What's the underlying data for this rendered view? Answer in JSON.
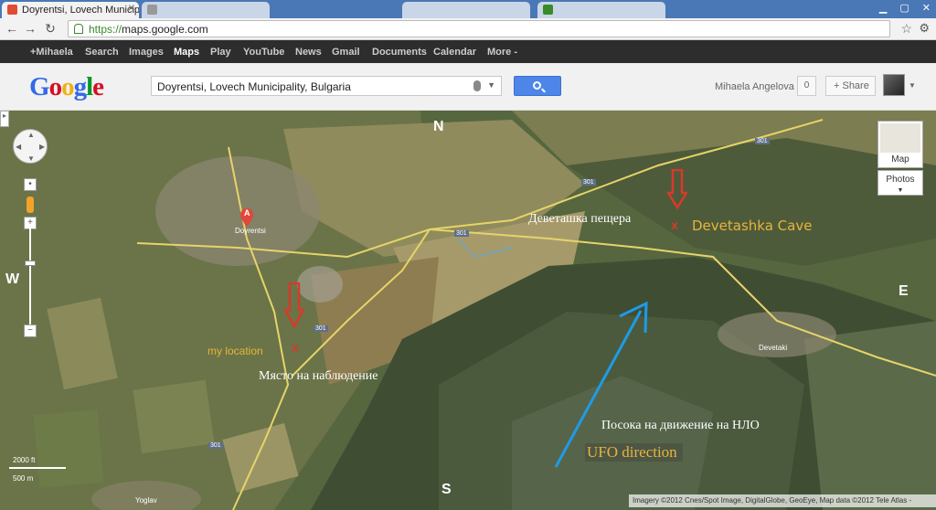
{
  "browser": {
    "tabs": [
      {
        "title": "Doyrentsi, Lovech Municipa",
        "active": true
      },
      {
        "title": "",
        "active": false
      },
      {
        "title": "",
        "active": false
      },
      {
        "title": "",
        "active": false
      }
    ],
    "url_scheme": "https://",
    "url_host": "maps.google.com"
  },
  "gbar": {
    "items": [
      "+Mihaela",
      "Search",
      "Images",
      "Maps",
      "Play",
      "YouTube",
      "News",
      "Gmail",
      "Documents",
      "Calendar",
      "More -"
    ],
    "active": "Maps"
  },
  "header": {
    "logo": "Google",
    "search_value": "Doyrentsi, Lovech Municipality, Bulgaria",
    "user_name": "Mihaela Angelova",
    "notification_count": "0",
    "share_label": "+ Share"
  },
  "map": {
    "compass": {
      "north": "N",
      "south": "S",
      "east": "E",
      "west": "W"
    },
    "place_labels": {
      "doyrentsi": "Doyrentsi",
      "devetaki": "Devetaki",
      "yoglav": "Yoglav"
    },
    "road_labels": {
      "r1": "301",
      "r2": "301",
      "r3": "301",
      "r4": "301",
      "r5": "301"
    },
    "marker_label": "A",
    "annotations": {
      "cave_bg": "Деветашка пещера",
      "cave_en": "Devetashka Cave",
      "my_location": "my location",
      "observation_bg": "Място на наблюдение",
      "ufo_bg": "Посока на движение на НЛО",
      "ufo_en": "UFO direction",
      "x_mark": "x"
    },
    "type_buttons": {
      "map": "Map",
      "photos": "Photos"
    },
    "scale": {
      "ft": "2000 ft",
      "m": "500 m"
    },
    "copyright": "Imagery ©2012 Cnes/Spot Image, DigitalGlobe, GeoEye, Map data ©2012 Tele Atlas -"
  },
  "colors": {
    "gbar_bg": "#2d2d2d",
    "search_blue": "#4d86e8",
    "annotation_yellow": "#e8b43a",
    "arrow_blue": "#1e9be8",
    "marker_red": "#d63a2b"
  }
}
